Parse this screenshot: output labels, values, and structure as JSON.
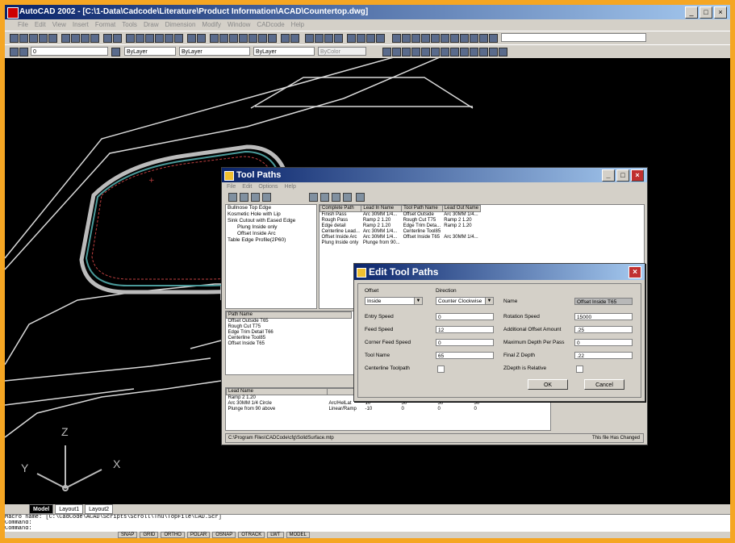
{
  "app": {
    "title": "AutoCAD 2002 - [C:\\1-Data\\Cadcode\\Literature\\Product Information\\ACAD\\Countertop.dwg]",
    "menu": [
      "File",
      "Edit",
      "View",
      "Insert",
      "Format",
      "Tools",
      "Draw",
      "Dimension",
      "Modify",
      "Window",
      "CADcode",
      "Help"
    ]
  },
  "toolbar": {
    "layer_combo": "0",
    "color_combo": "ByLayer",
    "linetype_combo": "ByLayer",
    "lineweight_combo": "ByLayer",
    "plotstyle_combo": "ByColor"
  },
  "ucs": {
    "x": "X",
    "y": "Y",
    "z": "Z"
  },
  "layout_tabs": [
    "Model",
    "Layout1",
    "Layout2"
  ],
  "command_lines": [
    "Macro name: [C:\\CadCode\\ACAD\\Scripts\\Scroll\\Thu\\TopFile\\CAD.Scr]",
    "Command:",
    "Command:"
  ],
  "status_buttons": [
    "SNAP",
    "GRID",
    "ORTHO",
    "POLAR",
    "OSNAP",
    "OTRACK",
    "LWT",
    "MODEL"
  ],
  "tool_paths": {
    "title": "Tool Paths",
    "menu": [
      "File",
      "Edit",
      "Options",
      "Help"
    ],
    "tree": [
      "Bullnose Top Edge",
      "Kosmetic Hole with Lip",
      "Sink Cutout with Eased Edge",
      "Plung Inside only",
      "Offset Inside Arc",
      "Table Edge Profile(2P60)"
    ],
    "top_grid": {
      "headers": [
        "Complete Path",
        "Lead In Name",
        "Tool Path Name",
        "Lead Out Name"
      ],
      "rows": [
        [
          "Finish Pass",
          "Arc 30MM 1/4...",
          "Offset Outside",
          "Arc 30MM 1/4..."
        ],
        [
          "Rough Pass",
          "Ramp 2 1.20",
          "Rough Cut T75",
          "Ramp 2 1.20"
        ],
        [
          "Edge detail",
          "Ramp 2 1.20",
          "Edge Trim Deta...",
          "Ramp 2 1.20"
        ],
        [
          "Centerline Lead...",
          "Arc 30MM 1/4...",
          "Centerline Tool85",
          ""
        ],
        [
          "Offset Inside Arc",
          "Arc 30MM 1/4...",
          "Offset Inside T65",
          "Arc 30MM 1/4..."
        ],
        [
          "Plung Inside only",
          "Plunge from 90...",
          "",
          ""
        ]
      ]
    },
    "mid_grid": {
      "headers": [
        "Path Name"
      ],
      "rows": [
        "Offset Outside T65",
        "Rough Cut T75",
        "Edge Trim Detail T66",
        "Centerline Tool85",
        "Offset Inside T65"
      ]
    },
    "bottom_grid": {
      "headers": [
        "Lead Name",
        "",
        "",
        "",
        "",
        ""
      ],
      "rows": [
        [
          "Ramp 2 1.20",
          "",
          "",
          "",
          "",
          ""
        ],
        [
          "Arc 30MM 1/4 Circle",
          "Arc/HelLat",
          "10",
          "30",
          "30",
          "30"
        ],
        [
          "Plunge from 90 above",
          "Linear/Ramp",
          "-10",
          "0",
          "0",
          "0"
        ]
      ]
    },
    "status_path": "C:\\Program Files\\CADCode\\cfg\\SolidSurface.mtp",
    "status_right": "This file Has Changed"
  },
  "edit_dialog": {
    "title": "Edit Tool Paths",
    "offset_label": "Offset",
    "offset_value": "Inside",
    "direction_label": "Direction",
    "direction_value": "Counter Clockwise",
    "name_label": "Name",
    "name_value": "Offset Inside T65",
    "left_fields": [
      {
        "label": "Entry Speed",
        "value": "0"
      },
      {
        "label": "Feed Speed",
        "value": "12"
      },
      {
        "label": "Corner Feed Speed",
        "value": "0"
      },
      {
        "label": "Tool Name",
        "value": "65"
      }
    ],
    "right_fields": [
      {
        "label": "Rotation Speed",
        "value": "15000"
      },
      {
        "label": "Additional Offset Amount",
        "value": ".25"
      },
      {
        "label": "Maximum Depth Per Pass",
        "value": "0"
      },
      {
        "label": "Final Z Depth",
        "value": ".22"
      }
    ],
    "centerline_label": "Centerline Toolpath",
    "zdepth_label": "ZDepth is Relative",
    "ok_label": "OK",
    "cancel_label": "Cancel"
  }
}
